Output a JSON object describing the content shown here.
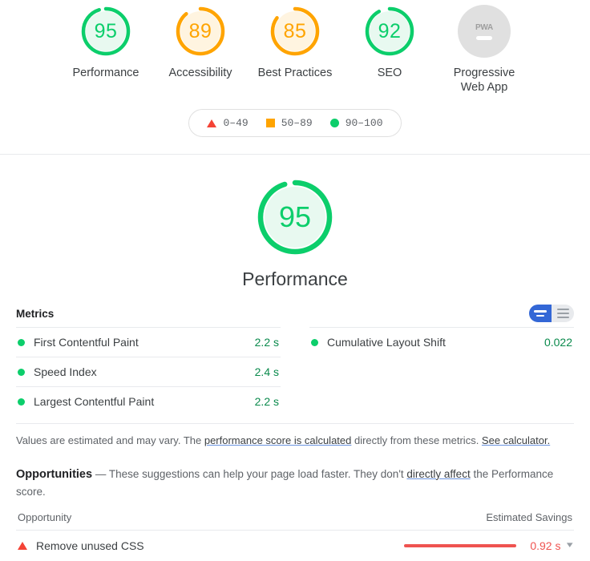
{
  "colors": {
    "green": "#0cce6b",
    "green_fill": "#e8f9f0",
    "orange": "#ffa400",
    "orange_fill": "#fff4e0",
    "red": "#ef5350",
    "gray": "#e0e0e0",
    "blue": "#3367d6"
  },
  "top_gauges": [
    {
      "score": "95",
      "label": "Performance",
      "color": "#0cce6b",
      "fill": "#e8f9f0",
      "pct": 95,
      "type": "gauge"
    },
    {
      "score": "89",
      "label": "Accessibility",
      "color": "#ffa400",
      "fill": "#fff4e0",
      "pct": 89,
      "type": "gauge"
    },
    {
      "score": "85",
      "label": "Best Practices",
      "color": "#ffa400",
      "fill": "#fff4e0",
      "pct": 85,
      "type": "gauge"
    },
    {
      "score": "92",
      "label": "SEO",
      "color": "#0cce6b",
      "fill": "#e8f9f0",
      "pct": 92,
      "type": "gauge"
    },
    {
      "score": "",
      "label": "Progressive Web App",
      "color": "#e0e0e0",
      "fill": "#e0e0e0",
      "pct": 0,
      "type": "pwa",
      "badge_text": "PWA"
    }
  ],
  "legend": [
    {
      "marker": "triangle-icon",
      "range": "0–49"
    },
    {
      "marker": "square-icon",
      "range": "50–89"
    },
    {
      "marker": "circle-icon",
      "range": "90–100"
    }
  ],
  "category": {
    "score": "95",
    "label": "Performance",
    "color": "#0cce6b",
    "fill": "#e8f9f0",
    "pct": 95
  },
  "metrics": {
    "title": "Metrics",
    "toggle": {
      "expanded_label": "expand-view-icon",
      "collapsed_label": "list-view-icon",
      "active": "expanded"
    },
    "left": [
      {
        "name": "First Contentful Paint",
        "value": "2.2 s",
        "status": "pass",
        "color": "#0cce6b"
      },
      {
        "name": "Speed Index",
        "value": "2.4 s",
        "status": "pass",
        "color": "#0cce6b"
      },
      {
        "name": "Largest Contentful Paint",
        "value": "2.2 s",
        "status": "pass",
        "color": "#0cce6b"
      }
    ],
    "right": [
      {
        "name": "Cumulative Layout Shift",
        "value": "0.022",
        "status": "pass",
        "color": "#0cce6b"
      }
    ],
    "disclaimer": {
      "part1": "Values are estimated and may vary. The ",
      "link1": "performance score is calculated",
      "part2": " directly from these metrics. ",
      "link2": "See calculator."
    }
  },
  "opportunities": {
    "heading": "Opportunities",
    "intro_part1": " — These suggestions can help your page load faster. They don't ",
    "intro_link": "directly affect",
    "intro_part2": " the Performance score.",
    "col_opportunity": "Opportunity",
    "col_savings": "Estimated Savings",
    "rows": [
      {
        "name": "Remove unused CSS",
        "savings": "0.92 s",
        "marker": "triangle-icon",
        "color": "#ef5350",
        "bar_pct": 100
      }
    ]
  }
}
